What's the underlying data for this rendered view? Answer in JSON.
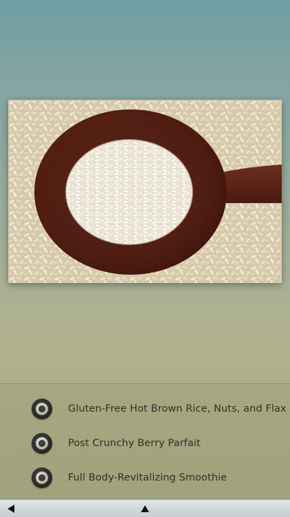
{
  "hero_image": {
    "description_icon": "rice-spoon-photo"
  },
  "menu": {
    "items": [
      {
        "label": "Gluten-Free Hot Brown Rice, Nuts, and Flax",
        "icon": "radio-button-icon"
      },
      {
        "label": "Post Crunchy Berry Parfait",
        "icon": "radio-button-icon"
      },
      {
        "label": "Full Body-Revitalizing Smoothie",
        "icon": "radio-button-icon"
      }
    ]
  },
  "toolbar": {
    "back_icon": "triangle-left-icon",
    "up_icon": "triangle-up-icon"
  },
  "colors": {
    "background_top": "#6f9ea3",
    "background_bottom": "#a9aa83",
    "label_text": "#2f2f25",
    "toolbar": "#d4d8db"
  }
}
